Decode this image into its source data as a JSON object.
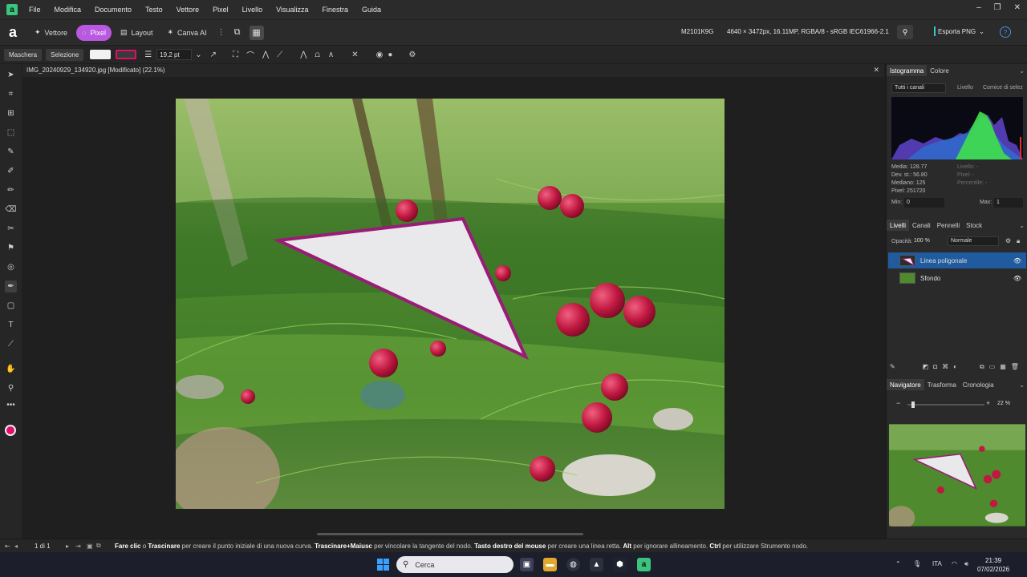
{
  "menu": [
    "File",
    "Modifica",
    "Documento",
    "Testo",
    "Vettore",
    "Pixel",
    "Livello",
    "Visualizza",
    "Finestra",
    "Guida"
  ],
  "toolbar": {
    "personas": [
      {
        "label": "Vettore",
        "active": false
      },
      {
        "label": "Pixel",
        "active": true
      },
      {
        "label": "Layout",
        "active": false
      },
      {
        "label": "Canva AI",
        "active": false
      }
    ],
    "doc_name": "M2101K9G",
    "doc_specs": "4640 × 3472px, 16.11MP, RGBA/8 - sRGB IEC61966-2.1",
    "export_label": "Esporta PNG",
    "help_icon": "question-mark-icon"
  },
  "context": {
    "mask_label": "Maschera",
    "selection_label": "Selezione",
    "fill_color": "#f2f2f2",
    "stroke_color": "#e0106a",
    "stroke_width": "19,2 pt"
  },
  "document": {
    "title": "IMG_20240929_134920.jpg [Modificato] (22.1%)"
  },
  "panels": {
    "histogram": {
      "tabs": [
        "Istogramma",
        "Colore"
      ],
      "channel": "Tutti i canali",
      "level_check": "Livello",
      "selection_frame": "Cornice di selez",
      "stats_left": [
        "Media: 128.77",
        "Dev. st.: 56.80",
        "Mediano: 125",
        "Pixel: 251720"
      ],
      "stats_right": [
        "Livello: -",
        "Pixel: -",
        "Percentile: -"
      ],
      "min_label": "Min:",
      "min_value": "0",
      "max_label": "Max:",
      "max_value": "1"
    },
    "layers": {
      "tabs": [
        "Livelli",
        "Canali",
        "Pennelli",
        "Stock"
      ],
      "opacity_label": "Opacità:",
      "opacity_value": "100 %",
      "blend_mode": "Normale",
      "items": [
        {
          "name": "Linea poligonale",
          "selected": true
        },
        {
          "name": "Sfondo",
          "selected": false
        }
      ]
    },
    "navigator": {
      "tabs": [
        "Navigatore",
        "Trasforma",
        "Cronologia"
      ],
      "zoom": "22 %",
      "zoom_fraction": 0.05
    }
  },
  "status": {
    "page": "1 di 1",
    "hint_parts": [
      {
        "t": "Fare clic",
        "b": true
      },
      {
        "t": " o ",
        "b": false
      },
      {
        "t": "Trascinare",
        "b": true
      },
      {
        "t": " per creare il punto iniziale di una nuova curva. ",
        "b": false
      },
      {
        "t": "Trascinare+Maiusc",
        "b": true
      },
      {
        "t": " per vincolare la tangente del nodo. ",
        "b": false
      },
      {
        "t": "Tasto destro del mouse",
        "b": true
      },
      {
        "t": " per creare una linea retta. ",
        "b": false
      },
      {
        "t": "Alt",
        "b": true
      },
      {
        "t": " per ignorare allineamento. ",
        "b": false
      },
      {
        "t": "Ctrl",
        "b": true
      },
      {
        "t": " per utilizzare Strumento nodo.",
        "b": false
      }
    ]
  },
  "taskbar": {
    "search_placeholder": "Cerca",
    "lang": "ITA",
    "time": "21:39",
    "date": "07/02/2026"
  }
}
